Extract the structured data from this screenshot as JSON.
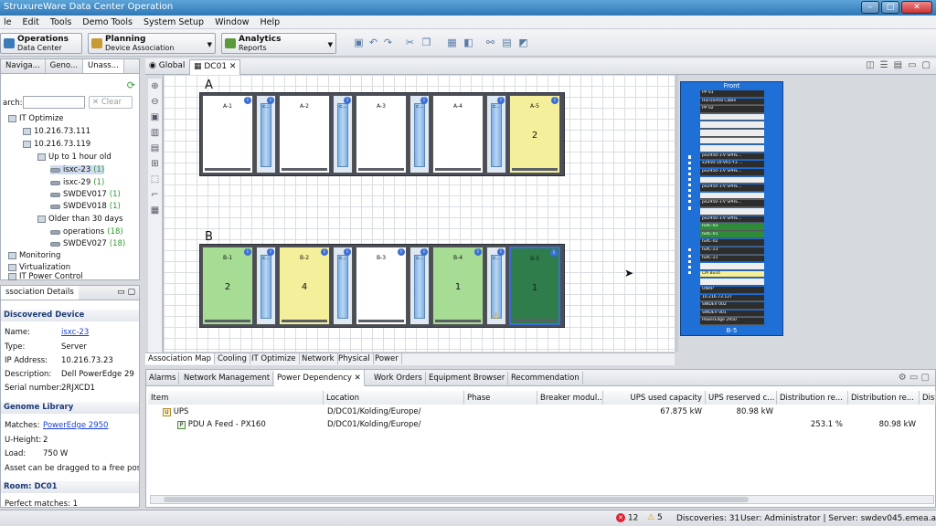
{
  "window": {
    "title": "StruxureWare Data Center Operation"
  },
  "menu": [
    "le",
    "Edit",
    "Tools",
    "Demo Tools",
    "System Setup",
    "Window",
    "Help"
  ],
  "modes": [
    {
      "title": "Operations",
      "sub": "Data Center"
    },
    {
      "title": "Planning",
      "sub": "Device Association"
    },
    {
      "title": "Analytics",
      "sub": "Reports"
    }
  ],
  "left_tabs": [
    "Naviga...",
    "Geno...",
    "Unass..."
  ],
  "search": {
    "label": "arch:",
    "clear": "Clear"
  },
  "tree": [
    {
      "label": "IT Optimize",
      "count": ""
    },
    {
      "label": "10.216.73.111",
      "count": ""
    },
    {
      "label": "10.216.73.119",
      "count": ""
    },
    {
      "label": "Up to 1 hour old",
      "count": ""
    },
    {
      "label": "isxc-23",
      "count": "(1)"
    },
    {
      "label": "isxc-29",
      "count": "(1)"
    },
    {
      "label": "SWDEV017",
      "count": "(1)"
    },
    {
      "label": "SWDEV018",
      "count": "(1)"
    },
    {
      "label": "Older than 30 days",
      "count": ""
    },
    {
      "label": "operations",
      "count": "(18)"
    },
    {
      "label": "SWDEV027",
      "count": "(18)"
    },
    {
      "label": "Monitoring",
      "count": ""
    },
    {
      "label": "Virtualization",
      "count": ""
    },
    {
      "label": "IT Power Control",
      "count": ""
    }
  ],
  "details": {
    "panel_title": "ssociation Details",
    "discovered_title": "Discovered Device",
    "rows": [
      {
        "k": "Name:",
        "v": "isxc-23"
      },
      {
        "k": "Type:",
        "v": "Server"
      },
      {
        "k": "IP Address:",
        "v": "10.216.73.23"
      },
      {
        "k": "Description:",
        "v": "Dell PowerEdge 29"
      },
      {
        "k": "Serial number:",
        "v": "2RJXCD1"
      }
    ],
    "genome_title": "Genome Library",
    "genome_rows": [
      {
        "k": "Matches:",
        "v": "PowerEdge 2950"
      },
      {
        "k": "U-Height:",
        "v": "2"
      },
      {
        "k": "Load:",
        "v": "750 W"
      }
    ],
    "drag_note": "Asset can be dragged to a free pos",
    "room_title": "Room: DC01",
    "perfect": "Perfect matches: 1"
  },
  "editor_tabs": [
    "Global",
    "DC01"
  ],
  "rows": [
    {
      "label": "A",
      "racks": [
        {
          "name": "A-1",
          "count": "",
          "color": "#ffffff"
        },
        {
          "name": "A-2",
          "count": "",
          "color": "#ffffff"
        },
        {
          "name": "A-3",
          "count": "",
          "color": "#ffffff"
        },
        {
          "name": "A-4",
          "count": "",
          "color": "#ffffff"
        },
        {
          "name": "A-5",
          "count": "2",
          "color": "#f4ef9a"
        }
      ]
    },
    {
      "label": "B",
      "racks": [
        {
          "name": "B-1",
          "count": "2",
          "color": "#a6dc94"
        },
        {
          "name": "B-2",
          "count": "4",
          "color": "#f4ef9a"
        },
        {
          "name": "B-3",
          "count": "",
          "color": "#ffffff"
        },
        {
          "name": "B-4",
          "count": "1",
          "color": "#a6dc94"
        },
        {
          "name": "B-5",
          "count": "1",
          "color": "#2e7d4a"
        }
      ]
    }
  ],
  "cooling_label": "c...",
  "view_tabs": [
    "Association Map",
    "Cooling",
    "IT Optimize",
    "Network",
    "Physical",
    "Power"
  ],
  "elevation": {
    "title": "Front",
    "footer": "B-5",
    "slots": [
      "PP 01",
      "Horizontal Cable",
      "PP 02",
      "",
      "",
      "",
      "",
      "",
      "pe2950-1-V SPHE...",
      "x2950-10-VR1-Y3 ...",
      "pe2950-1-V SPHE...",
      "",
      "pe2950-1-V SPHE...",
      "",
      "pe2950-1-V SPHE...",
      "",
      "pe2950-1-V SPHE...",
      "ISXC-03",
      "ISXC-01",
      "ISXC-02",
      "ISXC-23",
      "ISXC-21",
      "",
      "CM Build",
      "",
      "ONAP",
      "10.216.73.127",
      "SWDEV 002",
      "SWDEV 001",
      "PowerEdge 2950"
    ]
  },
  "bottom_tabs": [
    "Alarms",
    "Network Management",
    "Power Dependency",
    "Work Orders",
    "Equipment Browser",
    "Recommendation"
  ],
  "table": {
    "headers": [
      "Item",
      "Location",
      "Phase",
      "Breaker modul...",
      "UPS used capacity",
      "UPS reserved c...",
      "Distribution re...",
      "Distribution re...",
      "Dist"
    ],
    "rows": [
      {
        "item": "UPS",
        "location": "D/DC01/Kolding/Europe/",
        "phase": "",
        "breaker": "",
        "used": "67.875 kW",
        "reserved": "80.98 kW",
        "dist1": "",
        "dist2": ""
      },
      {
        "item": "PDU A Feed - PX160",
        "location": "D/DC01/Kolding/Europe/",
        "phase": "",
        "breaker": "",
        "used": "",
        "reserved": "",
        "dist1": "253.1 %",
        "dist2": "80.98 kW"
      }
    ]
  },
  "status": {
    "errors": "12",
    "warnings": "5",
    "discoveries": "Discoveries: 31",
    "user": "User: Administrator | Server: swdev045.emea.apc.com"
  },
  "colors": {
    "accent": "#2e78b6",
    "elevation": "#1e6fd6"
  }
}
